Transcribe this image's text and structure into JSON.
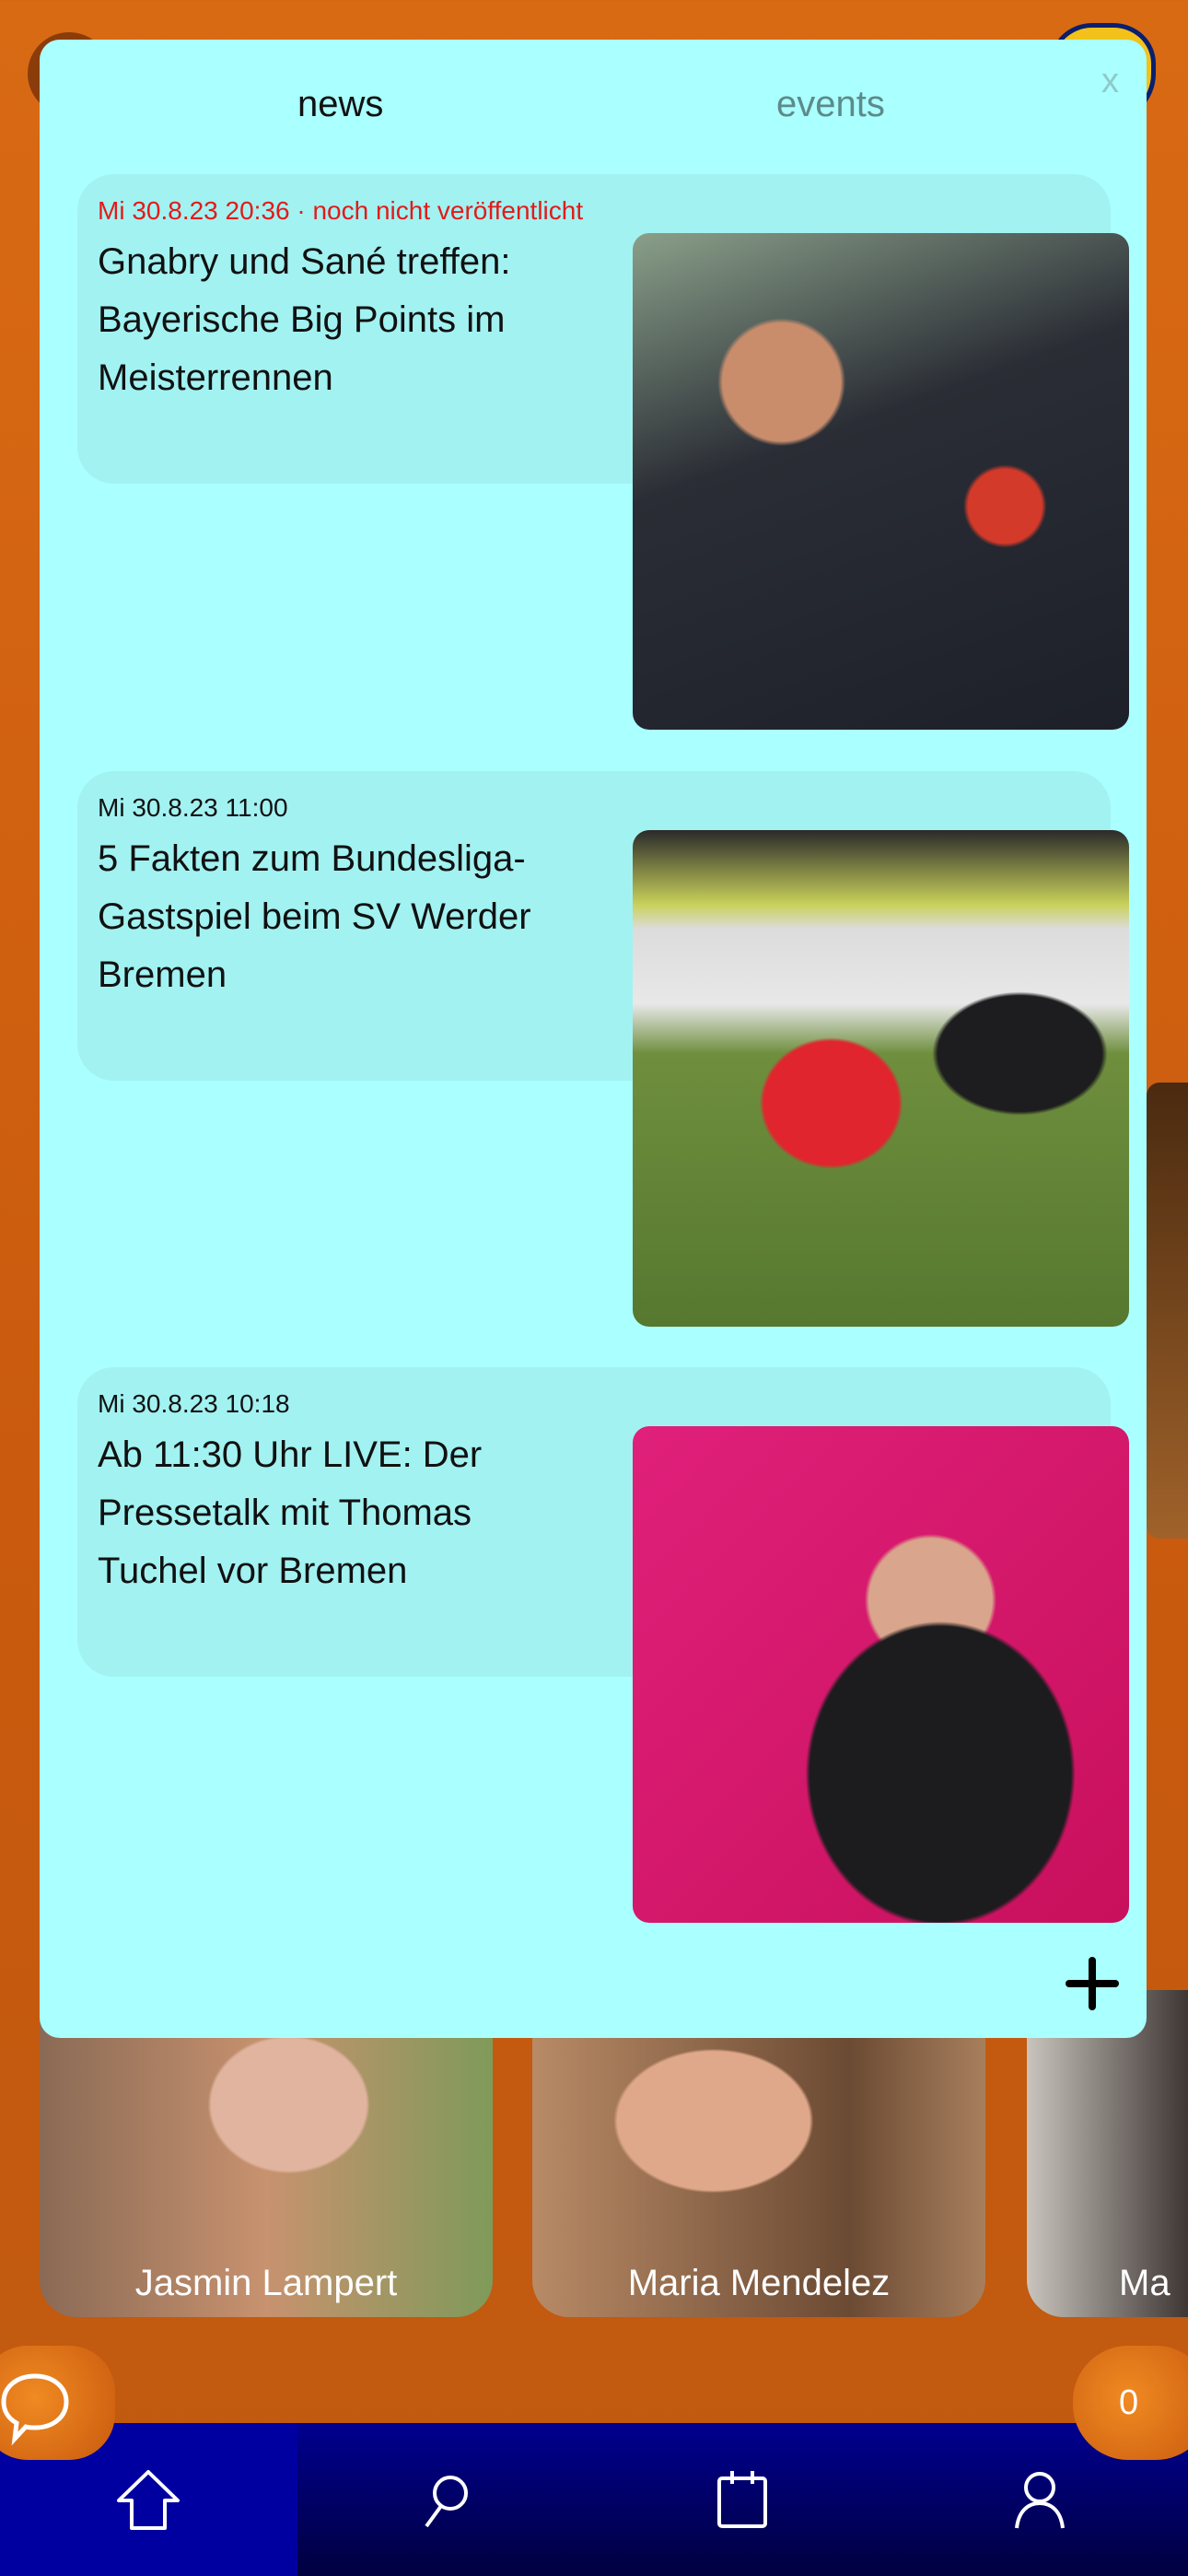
{
  "modal": {
    "tabs": [
      {
        "label": "news",
        "active": true
      },
      {
        "label": "events",
        "active": false
      }
    ],
    "close_label": "x",
    "news": [
      {
        "date": "Mi 30.8.23 20:36 · noch nicht veröffentlicht",
        "title": "Gnabry und Sané treffen: Bayerische Big Points im Meisterrennen",
        "unpublished": true
      },
      {
        "date": "Mi 30.8.23 11:00",
        "title": "5 Fakten zum Bundesliga-Gastspiel beim SV Werder Bremen",
        "unpublished": false
      },
      {
        "date": "Mi 30.8.23 10:18",
        "title": "Ab 11:30 Uhr LIVE: Der Pressetalk mit Thomas Tuchel vor Bremen",
        "unpublished": false
      }
    ]
  },
  "people": [
    {
      "name": "Jasmin Lampert"
    },
    {
      "name": "Maria Mendelez"
    },
    {
      "name": "Ma"
    }
  ],
  "counter": "0",
  "nav": [
    {
      "icon": "home-icon"
    },
    {
      "icon": "search-icon"
    },
    {
      "icon": "calendar-icon"
    },
    {
      "icon": "profile-icon"
    }
  ],
  "colors": {
    "background": "#d96a14",
    "modal": "#aaffff",
    "card": "#a2f2f2",
    "nav": "#00008f",
    "unpublished": "#e41a1a"
  }
}
